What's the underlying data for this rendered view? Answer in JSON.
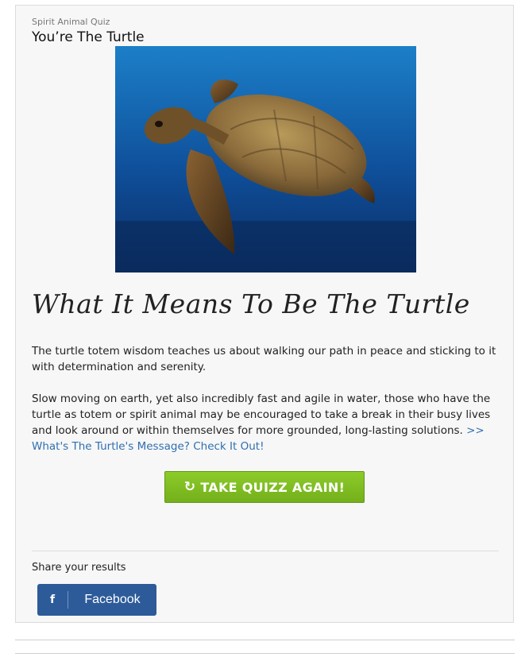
{
  "card": {
    "quiz_name": "Spirit Animal Quiz",
    "result_title": "You’re The Turtle",
    "image_alt": "sea turtle swimming in blue water",
    "heading": "What It Means To Be The Turtle",
    "paragraph1": "The turtle totem wisdom teaches us about walking our path in peace and sticking to it with determination and serenity.",
    "paragraph2": "Slow moving on earth, yet also incredibly fast and agile in water, those who have the turtle as totem or spirit animal may be encouraged to take a break in their busy lives and look around or within themselves for more grounded, long-lasting solutions.",
    "more_link": ">> What's The Turtle's Message? Check It Out!",
    "retake_label": "TAKE QUIZZ AGAIN!",
    "retake_icon": "refresh-icon"
  },
  "share": {
    "label": "Share your results",
    "facebook_label": "Facebook",
    "facebook_icon": "facebook-icon"
  },
  "colors": {
    "accent_green": "#7dbd22",
    "link_blue": "#2f6fb0",
    "facebook_blue": "#2d5b9a"
  }
}
